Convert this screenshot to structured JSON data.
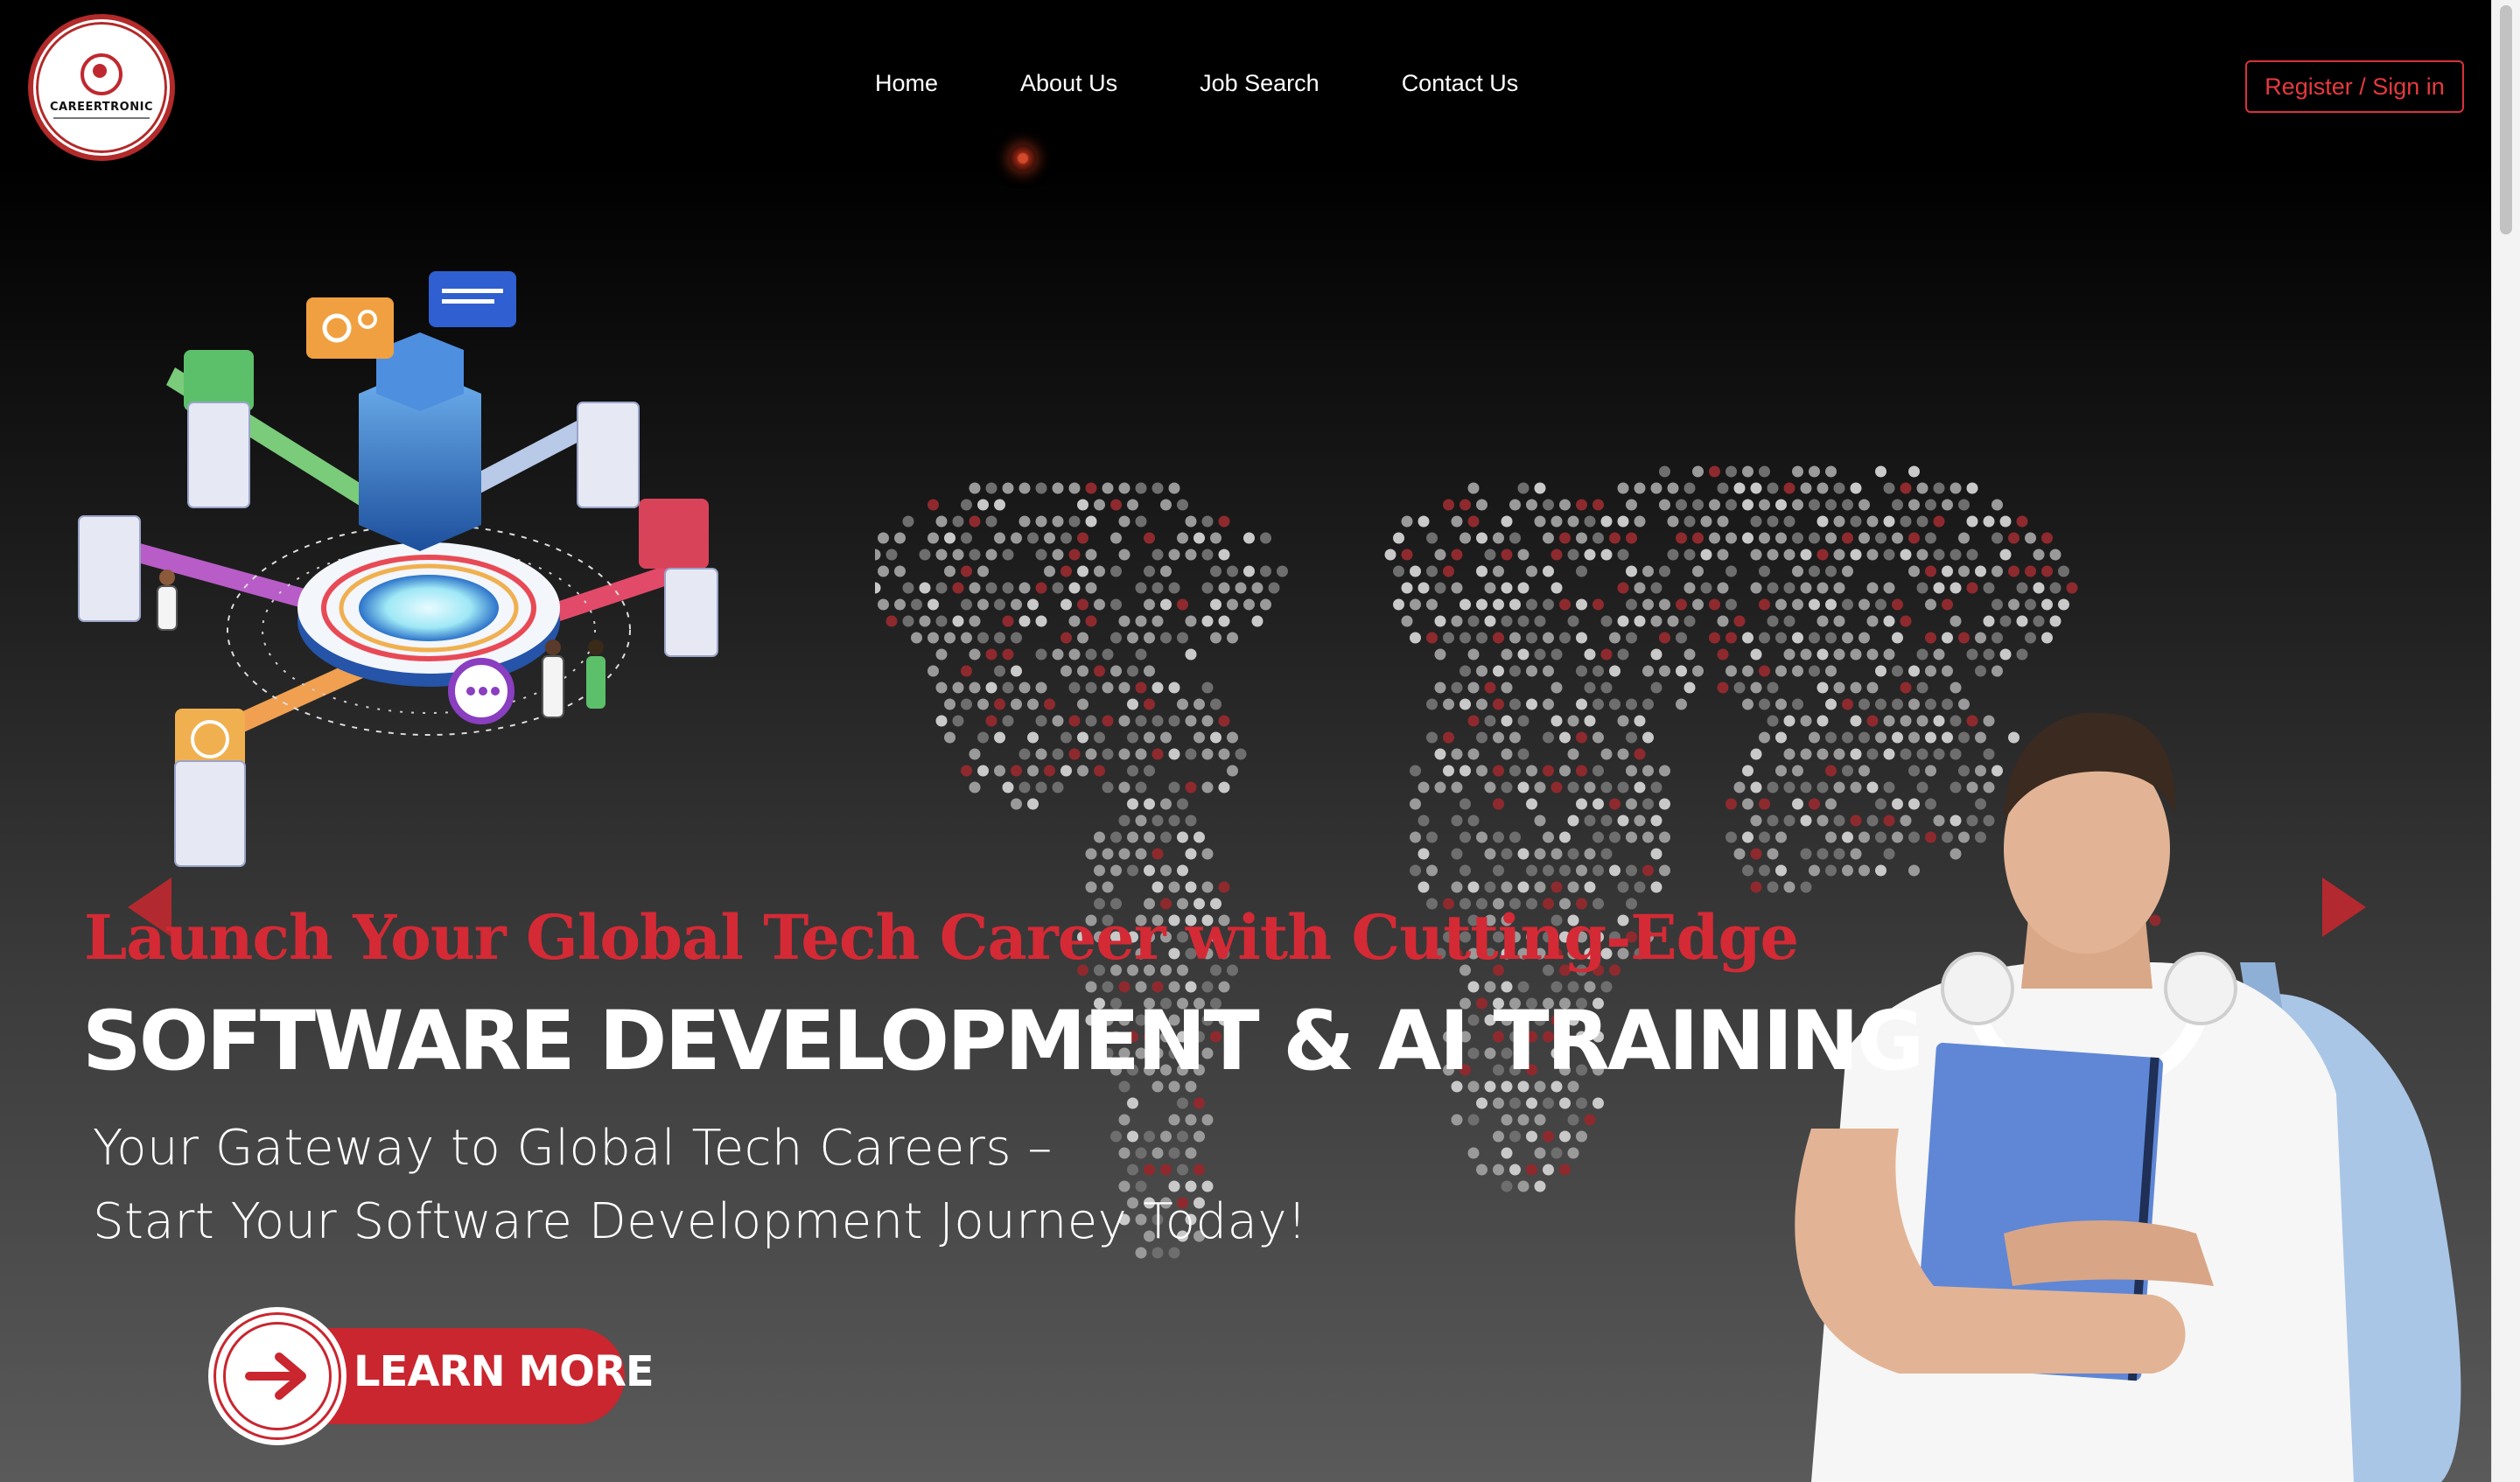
{
  "header": {
    "logo_text": "CAREERTRONIC",
    "nav": [
      "Home",
      "About Us",
      "Job Search",
      "Contact Us"
    ],
    "register_label": "Register / Sign in"
  },
  "hero": {
    "headline": "Launch Your Global Tech Career with Cutting-Edge",
    "title": "SOFTWARE DEVELOPMENT & AI TRAINING",
    "subtitle_line1": "Your Gateway to Global Tech Careers –",
    "subtitle_line2": "Start Your Software Development Journey Today!",
    "cta_label": "LEARN MORE"
  },
  "icons": {
    "prev": "arrow-left-icon",
    "next": "arrow-right-icon",
    "cta": "arrow-right-icon"
  },
  "colors": {
    "accent": "#d42a35",
    "background": "#000000",
    "button": "#c9262f"
  }
}
